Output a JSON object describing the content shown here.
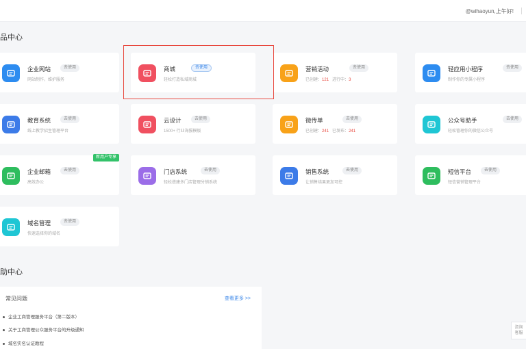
{
  "header": {
    "user": "@wihaoyun,上午好!"
  },
  "sections": {
    "products_title": "品中心",
    "help_title": "助中心"
  },
  "cards": [
    {
      "name": "企业网站",
      "tag": "去使用",
      "desc": "网站制作，维护服务",
      "color": "#2d8cf0"
    },
    {
      "name": "商城",
      "tag": "去使用",
      "desc": "轻松打造私域商城",
      "color": "#f05060",
      "active": true
    },
    {
      "name": "营销活动",
      "tag": "去使用",
      "desc_pre": "已创建：",
      "desc_red": "121",
      "desc_mid": "进行中：",
      "desc_end": "3",
      "color": "#f8a219"
    },
    {
      "name": "轻应用小程序",
      "tag": "去使用",
      "desc": "制作你的专属小程序",
      "color": "#2d8cf0"
    },
    {
      "name": "教育系统",
      "tag": "去使用",
      "desc": "线上教学招生管理平台",
      "color": "#3c7be8"
    },
    {
      "name": "云设计",
      "tag": "去使用",
      "desc": "1500+ 行业海报模板",
      "color": "#f05060"
    },
    {
      "name": "微传单",
      "tag": "去使用",
      "desc_pre": "已创建：",
      "desc_red": "241",
      "desc_mid": "已发布：",
      "desc_end": "241",
      "color": "#f8a219"
    },
    {
      "name": "公众号助手",
      "tag": "去使用",
      "desc": "轻松管理你的微信公众号",
      "color": "#1fc6d4"
    },
    {
      "name": "企业邮箱",
      "tag": "去使用",
      "desc": "高效办公",
      "color": "#2ebd5e",
      "ribbon": "新用户专享"
    },
    {
      "name": "门店系统",
      "tag": "去使用",
      "desc": "轻松搭建多门店管理分销系统",
      "color": "#9b6de8"
    },
    {
      "name": "销售系统",
      "tag": "去使用",
      "desc": "让销售结果更加可控",
      "color": "#3c7be8"
    },
    {
      "name": "短信平台",
      "tag": "去使用",
      "desc": "短信营销管理平台",
      "color": "#2ebd5e"
    },
    {
      "name": "域名管理",
      "tag": "去使用",
      "desc": "快速选择你的域名",
      "color": "#1fc6d4"
    }
  ],
  "help": {
    "title": "常见问题",
    "more": "查看更多 >>",
    "items": [
      "企业工商管理服务平台（第二版本）",
      "关于工商管理公众服务平台的升级通知",
      "域名实名认证教程"
    ]
  },
  "float_button": {
    "line1": "咨询",
    "line2": "客服"
  }
}
